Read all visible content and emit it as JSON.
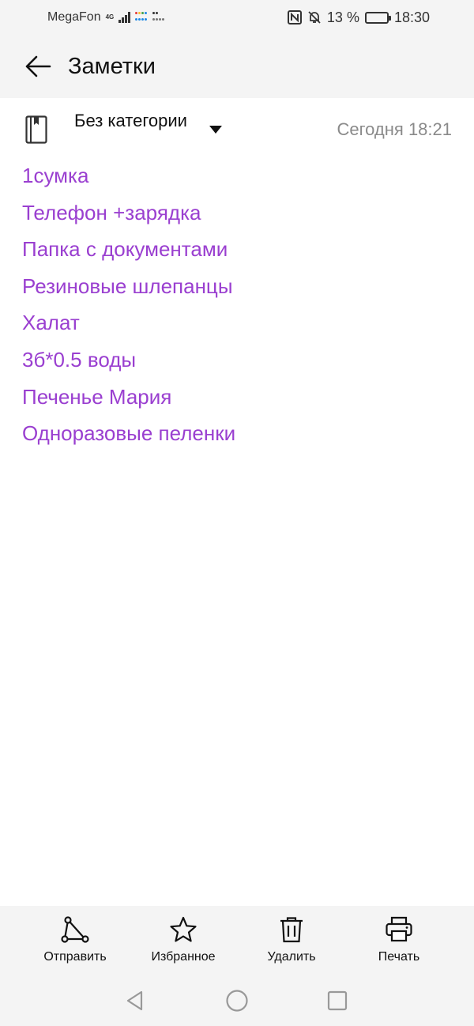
{
  "status_bar": {
    "carrier": "MegaFon",
    "network": "4G",
    "battery_percent": "13 %",
    "battery_level": 0.13,
    "time": "18:30",
    "icons": [
      "nfc-icon",
      "bell-muted-icon",
      "battery-icon"
    ]
  },
  "app_bar": {
    "title": "Заметки",
    "back_icon": "arrow-left-icon"
  },
  "note": {
    "category": "Без категории",
    "date": "Сегодня 18:21",
    "lines": [
      "1сумка",
      "Телефон +зарядка",
      "Папка с документами",
      "Резиновые шлепанцы",
      "Халат",
      "3б*0.5 воды",
      "Печенье Мария",
      "Одноразовые пеленки"
    ]
  },
  "toolbar": {
    "share_label": "Отправить",
    "favorite_label": "Избранное",
    "delete_label": "Удалить",
    "print_label": "Печать"
  },
  "colors": {
    "note_text": "#9a3fd0",
    "bar_bg": "#f4f4f4",
    "date_text": "#8a8a8a"
  }
}
